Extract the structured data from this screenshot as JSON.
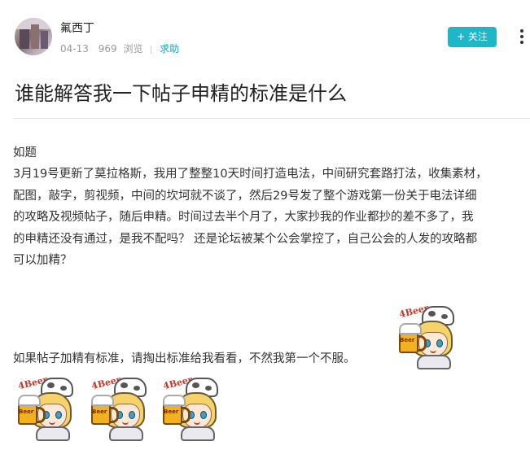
{
  "post": {
    "username": "氟西丁",
    "date": "04-13",
    "views": "969",
    "views_label": "浏览",
    "tag": "求助",
    "follow_label": "+ 关注",
    "title": "谁能解答我一下帖子申精的标准是什么",
    "body_lines": [
      "如题",
      "3月19号更新了莫拉格斯，我用了整整10天时间打造电法，中间研究套路打法，收集素材，",
      "配图，敲字，剪视频，中间的坎坷就不谈了，然后29号发了整个游戏第一份关于电法详细",
      "的攻略及视频帖子，随后申精。时间过去半个月了，大家抄我的作业都抄的差不多了，我",
      "的申精还没有通过，是我不配吗？ 还是论坛被某个公会掌控了，自己公会的人发的攻略都",
      "可以加精？"
    ],
    "closing_line": "如果帖子加精有标准，请掏出标准给我看看，不然我第一个不服。"
  },
  "sticker": {
    "beer_text": "4Beer",
    "mug_label": "Beer",
    "icon": "cow-girl-beer-sticker-icon"
  },
  "colors": {
    "accent": "#1fb6c7",
    "tag": "#1aa7b8",
    "text": "#333333",
    "meta": "#999999"
  }
}
